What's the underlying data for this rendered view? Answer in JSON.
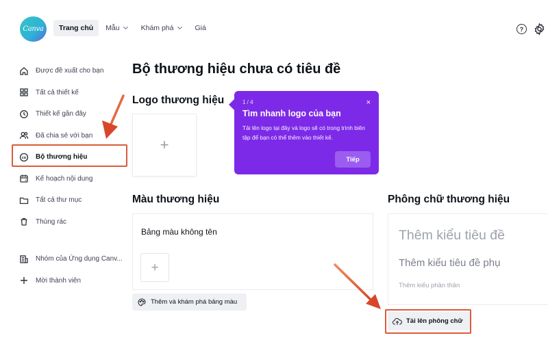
{
  "app": {
    "logo_text": "Canva",
    "brand_color": "#7d2ae8"
  },
  "nav": {
    "items": [
      {
        "label": "Trang chủ",
        "active": true,
        "dropdown": false
      },
      {
        "label": "Mẫu",
        "active": false,
        "dropdown": true
      },
      {
        "label": "Khám phá",
        "active": false,
        "dropdown": true
      },
      {
        "label": "Giá",
        "active": false,
        "dropdown": false
      }
    ],
    "help_icon": "question-circle-icon",
    "settings_icon": "gear-icon"
  },
  "sidebar": {
    "items": [
      {
        "label": "Được đề xuất cho bạn",
        "icon": "home-icon"
      },
      {
        "label": "Tất cả thiết kế",
        "icon": "grid-icon"
      },
      {
        "label": "Thiết kế gần đây",
        "icon": "clock-icon"
      },
      {
        "label": "Đã chia sẻ với bạn",
        "icon": "users-icon"
      },
      {
        "label": "Bộ thương hiệu",
        "icon": "brand-kit-icon",
        "active": true
      },
      {
        "label": "Kế hoạch nội dung",
        "icon": "calendar-icon"
      },
      {
        "label": "Tất cả thư mục",
        "icon": "folder-icon"
      },
      {
        "label": "Thùng rác",
        "icon": "trash-icon"
      }
    ],
    "team_items": [
      {
        "label": "Nhóm của Ứng dụng Canv...",
        "icon": "building-icon"
      },
      {
        "label": "Mời thành viên",
        "icon": "plus-icon"
      }
    ]
  },
  "main": {
    "title": "Bộ thương hiệu chưa có tiêu đề",
    "logo_section": {
      "title": "Logo thương hiệu"
    },
    "tooltip": {
      "step": "1 / 4",
      "title": "Tìm nhanh logo của bạn",
      "body": "Tải lên logo tại đây và logo sẽ có trong trình biên tập để bạn có thể thêm vào thiết kế.",
      "next_label": "Tiếp",
      "close": "×"
    },
    "color_section": {
      "title": "Màu thương hiệu",
      "palette_name": "Bảng màu không tên",
      "explore_label": "Thêm và khám phá bảng màu"
    },
    "font_section": {
      "title": "Phông chữ thương hiệu",
      "heading": "Thêm kiểu tiêu đề",
      "subheading": "Thêm kiểu tiêu đề phụ",
      "body": "Thêm kiểu phần thân",
      "upload_label": "Tải lên phông chữ"
    }
  },
  "annotations": {
    "highlight_color": "#d95b3b"
  }
}
